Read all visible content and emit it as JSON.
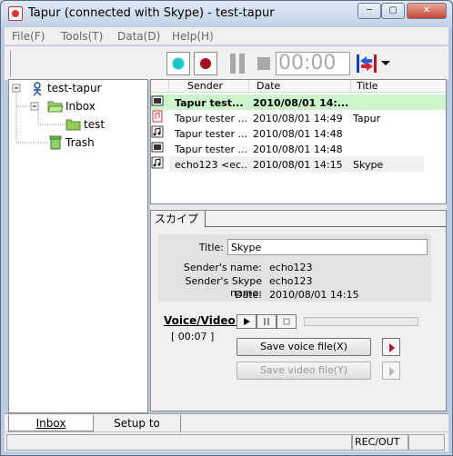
{
  "window": {
    "title": "Tapur (connected with Skype) - test-tapur",
    "min_glyph": "─",
    "max_glyph": "▢",
    "close_glyph": "✕"
  },
  "menu": [
    "File(F)",
    "Tools(T)",
    "Data(D)",
    "Help(H)"
  ],
  "toolbar": {
    "timer": "00:00",
    "play_icon": "record-start-icon",
    "rec_icon": "record-stop-icon",
    "colors": {
      "play": "#19c7c7",
      "rec": "#a50e1e"
    }
  },
  "tree": {
    "root": "test-tapur",
    "inbox": "Inbox",
    "test": "test",
    "trash": "Trash"
  },
  "list": {
    "columns": [
      "Sender",
      "Date",
      "Title"
    ],
    "rows": [
      {
        "icon": "voice-video-icon",
        "sender": "Tapur test...",
        "date": "2010/08/01 14:...",
        "title": "",
        "bold": true,
        "selected": true
      },
      {
        "icon": "voice-file-icon",
        "sender": "Tapur tester ...",
        "date": "2010/08/01 14:49",
        "title": "Tapur",
        "bold": false
      },
      {
        "icon": "music-icon",
        "sender": "Tapur tester ...",
        "date": "2010/08/01 14:48",
        "title": "",
        "bold": false
      },
      {
        "icon": "voice-video-icon",
        "sender": "Tapur tester ...",
        "date": "2010/08/01 14:48",
        "title": "",
        "bold": false
      },
      {
        "icon": "music-icon",
        "sender": "echo123 <ec...",
        "date": "2010/08/01 14:15",
        "title": "Skype",
        "bold": false,
        "highlight": true
      }
    ]
  },
  "detail": {
    "tab": "スカイプ",
    "title_label": "Title:",
    "title_value": "Skype",
    "sender_name_label": "Sender's name:",
    "sender_name": "echo123",
    "sender_skype_label": "Sender's Skype name:",
    "sender_skype": "echo123",
    "date_label": "Date:",
    "date": "2010/08/01 14:15",
    "voice_video_label": "Voice/Video:",
    "duration": "[ 00:07 ]",
    "save_voice": "Save voice file(X)",
    "save_video": "Save video file(Y)"
  },
  "bottom_tabs": [
    "Inbox",
    "Setup to"
  ],
  "status": {
    "rec": "REC/OUT"
  }
}
